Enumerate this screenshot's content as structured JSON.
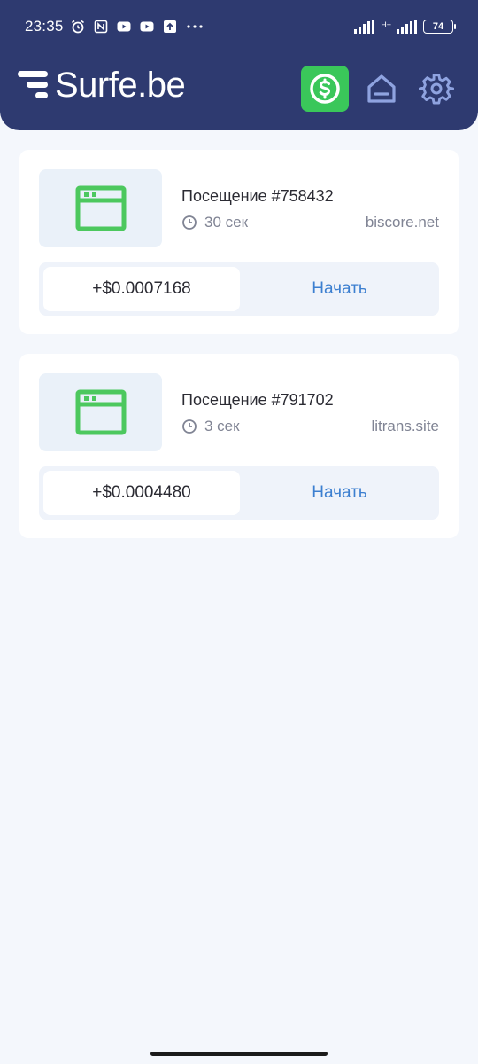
{
  "status_bar": {
    "time": "23:35",
    "left_icons": [
      "alarm-icon",
      "nfc-icon",
      "youtube-icon",
      "youtube-icon",
      "upload-icon",
      "more-dots-icon"
    ],
    "network": "H+",
    "battery": "74"
  },
  "header": {
    "logo_text": "Surfe.be",
    "buttons": [
      "dollar-icon",
      "home-icon",
      "gear-icon"
    ],
    "colors": {
      "background": "#2e3a70",
      "accent": "#3ac75a"
    }
  },
  "tasks": [
    {
      "title": "Посещение #758432",
      "duration": "30 сек",
      "site": "biscore.net",
      "reward": "+$0.0007168",
      "action": "Начать"
    },
    {
      "title": "Посещение #791702",
      "duration": "3 сек",
      "site": "litrans.site",
      "reward": "+$0.0004480",
      "action": "Начать"
    }
  ]
}
